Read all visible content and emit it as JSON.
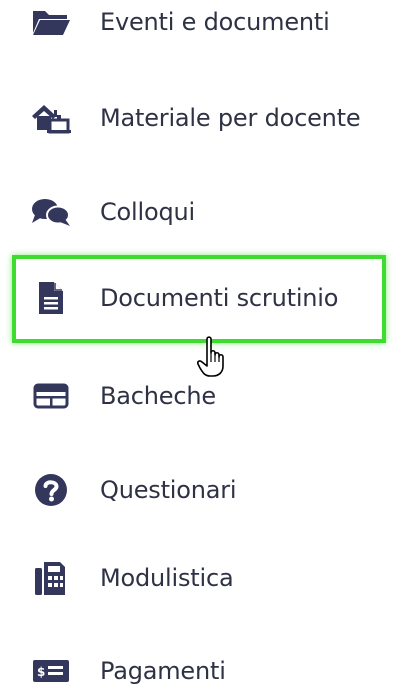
{
  "menu": {
    "items": [
      {
        "label": "Eventi e documenti",
        "icon": "folder-open-icon"
      },
      {
        "label": "Materiale per docente",
        "icon": "house-chalkboard-icon"
      },
      {
        "label": "Colloqui",
        "icon": "chat-bubbles-icon"
      },
      {
        "label": "Documenti scrutinio",
        "icon": "document-file-icon",
        "highlighted": true
      },
      {
        "label": "Bacheche",
        "icon": "bulletin-board-icon"
      },
      {
        "label": "Questionari",
        "icon": "question-circle-icon"
      },
      {
        "label": "Modulistica",
        "icon": "fax-form-icon"
      },
      {
        "label": "Pagamenti",
        "icon": "money-bill-icon"
      }
    ]
  },
  "colors": {
    "icon": "#34375c",
    "text": "#2f3245",
    "highlight": "#3ddc2f"
  }
}
